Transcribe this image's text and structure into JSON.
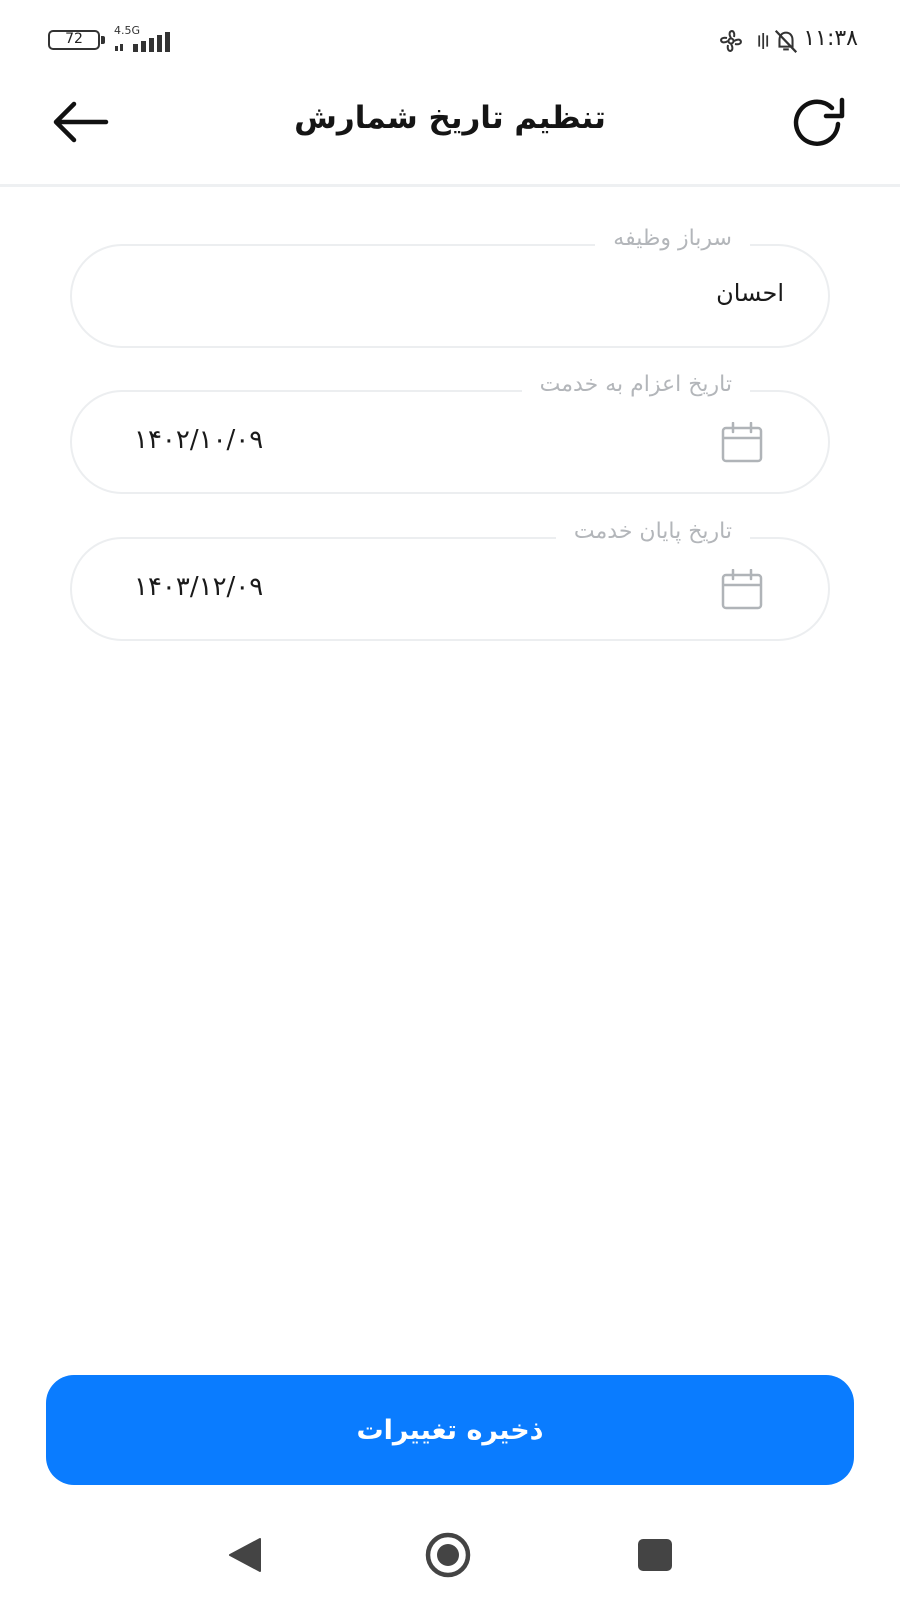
{
  "status_bar": {
    "battery_level": "72",
    "network_type": "4.5G",
    "time": "۱۱:۳۸",
    "icons": [
      "battery-icon",
      "signal-icon",
      "pinwheel-icon",
      "vibrate-icon",
      "muted-bell-icon"
    ]
  },
  "header": {
    "title": "تنظیم تاریخ شمارش",
    "back_icon": "arrow-left-icon",
    "refresh_icon": "refresh-icon"
  },
  "form": {
    "soldier": {
      "label": "سرباز وظیفه",
      "value": "احسان"
    },
    "dispatch_date": {
      "label": "تاریخ اعزام به خدمت",
      "value": "۱۴۰۲/۱۰/۰۹",
      "icon": "calendar-icon"
    },
    "end_date": {
      "label": "تاریخ پایان خدمت",
      "value": "۱۴۰۳/۱۲/۰۹",
      "icon": "calendar-icon"
    }
  },
  "actions": {
    "save_label": "ذخیره تغییرات"
  },
  "colors": {
    "accent": "#0a7cff",
    "border": "#eceef0",
    "label": "#b3b6ba"
  },
  "nav_bar": {
    "icons": [
      "nav-back-icon",
      "nav-home-icon",
      "nav-recents-icon"
    ]
  }
}
